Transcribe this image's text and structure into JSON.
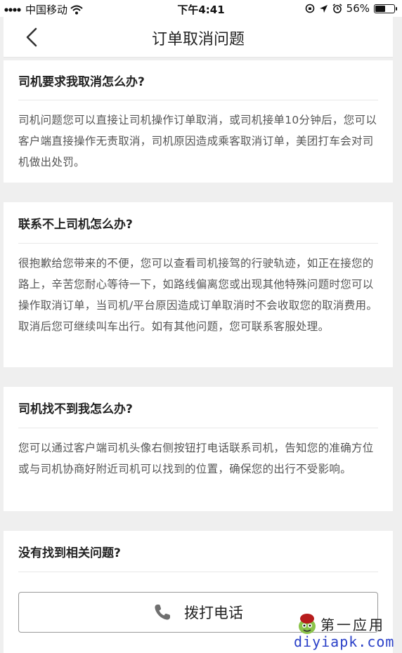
{
  "status_bar": {
    "carrier": "中国移动",
    "time": "下午4:41",
    "battery": "56%",
    "battery_level": 0.56
  },
  "header": {
    "title": "订单取消问题"
  },
  "faq": [
    {
      "question": "司机要求我取消怎么办?",
      "answer": "司机问题您可以直接让司机操作订单取消，或司机接单10分钟后，您可以客户端直接操作无责取消，司机原因造成乘客取消订单，美团打车会对司机做出处罚。"
    },
    {
      "question": "联系不上司机怎么办?",
      "answer": "很抱歉给您带来的不便，您可以查看司机接驾的行驶轨迹，如正在接您的路上，辛苦您耐心等待一下，如路线偏离您或出现其他特殊问题时您可以操作取消订单，当司机/平台原因造成订单取消时不会收取您的取消费用。取消后您可继续叫车出行。如有其他问题，您可联系客服处理。"
    },
    {
      "question": "司机找不到我怎么办?",
      "answer": "您可以通过客户端司机头像右侧按钮打电话联系司机，告知您的准确方位或与司机协商好附近司机可以找到的位置，确保您的出行不受影响。"
    }
  ],
  "footer": {
    "prompt": "没有找到相关问题?",
    "call_label": "拨打电话"
  },
  "watermark": {
    "name": "第一应用",
    "domain": "diyiapk.com"
  }
}
